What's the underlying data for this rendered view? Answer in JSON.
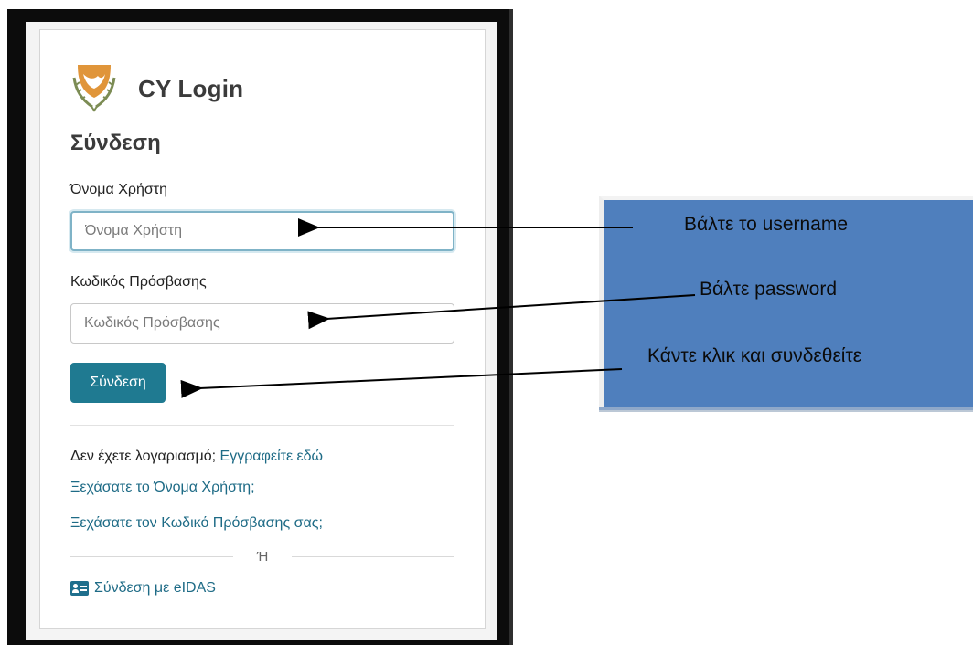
{
  "app": {
    "brand_title": "CY Login",
    "heading": "Σύνδεση"
  },
  "form": {
    "username_label": "Όνομα Χρήστη",
    "username_placeholder": "Όνομα Χρήστη",
    "password_label": "Κωδικός Πρόσβασης",
    "password_placeholder": "Κωδικός Πρόσβασης",
    "submit_label": "Σύνδεση"
  },
  "links": {
    "no_account_text": "Δεν έχετε λογαριασμό;",
    "register_link": "Εγγραφείτε εδώ",
    "forgot_username": "Ξεχάσατε το Όνομα Χρήστη;",
    "forgot_password": "Ξεχάσατε τον Κωδικό Πρόσβασης σας;",
    "or_text": "Ή",
    "eidas_link": "Σύνδεση με eIDAS"
  },
  "annotations": {
    "username_note": "Βάλτε το username",
    "password_note": "Βάλτε password",
    "submit_note": "Κάντε κλικ και συνδεθείτε"
  },
  "colors": {
    "primary_button": "#1f7a91",
    "link": "#1e6b86",
    "note_box": "#4f7fbd",
    "emblem_gold": "#e0953a"
  },
  "icons": {
    "brand": "cyprus-emblem-icon",
    "eidas": "id-card-icon"
  }
}
